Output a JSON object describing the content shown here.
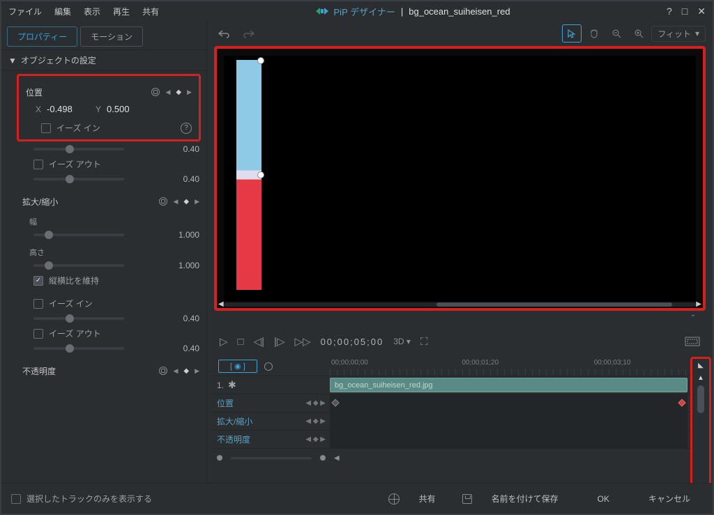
{
  "menu": {
    "file": "ファイル",
    "edit": "編集",
    "view": "表示",
    "play": "再生",
    "share": "共有"
  },
  "title": {
    "app": "PiP デザイナー",
    "sep": "|",
    "file": "bg_ocean_suiheisen_red"
  },
  "syscontrols": {
    "help": "?",
    "max": "□",
    "close": "✕"
  },
  "tabs": {
    "property": "プロパティー",
    "motion": "モーション"
  },
  "section": {
    "object": "オブジェクトの設定"
  },
  "props": {
    "position": "位置",
    "x_label": "X",
    "x_value": "-0.498",
    "y_label": "Y",
    "y_value": "0.500",
    "ease_in": "イーズ イン",
    "ease_out": "イーズ アウト",
    "val040": "0.40",
    "scale": "拡大/縮小",
    "width": "幅",
    "width_val": "1.000",
    "height": "高さ",
    "height_val": "1.000",
    "lock_ratio": "縦横比を維持",
    "opacity": "不透明度"
  },
  "bottomchk": "選択したトラックのみを表示する",
  "fit": "フィット",
  "timecode": "00;00;05;00",
  "threeD": "3D",
  "ruler": {
    "t0": "00;00;00;00",
    "t1": "00;00;01;20",
    "t2": "00;00;03;10"
  },
  "tl": {
    "eye": "[ ◉ ]",
    "track1": "1.",
    "clip": "bg_ocean_suiheisen_red.jpg",
    "position": "位置",
    "scale": "拡大/縮小",
    "opacity": "不透明度"
  },
  "buttons": {
    "share": "共有",
    "saveas": "名前を付けて保存",
    "ok": "OK",
    "cancel": "キャンセル"
  }
}
